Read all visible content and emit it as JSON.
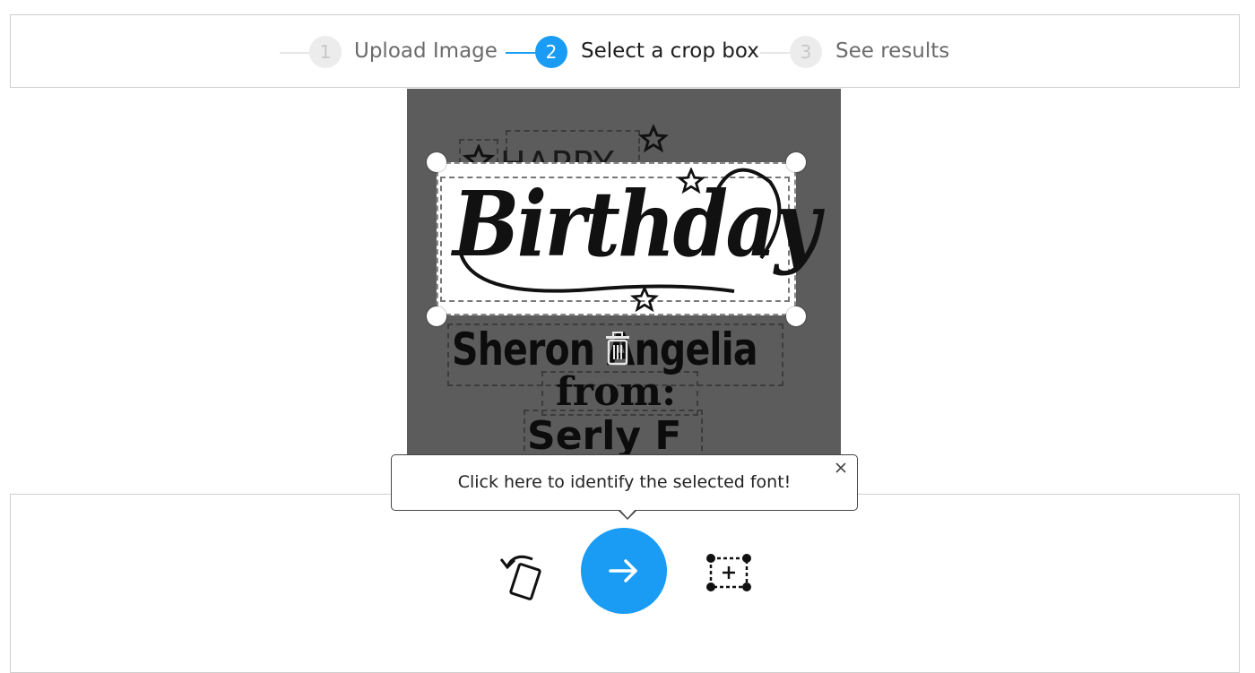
{
  "stepper": {
    "steps": [
      {
        "number": "1",
        "label": "Upload Image",
        "state": "inactive"
      },
      {
        "number": "2",
        "label": "Select a crop box",
        "state": "active"
      },
      {
        "number": "3",
        "label": "See results",
        "state": "inactive"
      }
    ]
  },
  "image": {
    "happy": "HAPPY",
    "birthday": "Birthday",
    "name": "Sheron Angelia",
    "from": "from:",
    "sender": "Serly F"
  },
  "tooltip": {
    "text": "Click here to identify the selected font!",
    "close_icon": "close-icon"
  },
  "toolbar": {
    "rotate_icon": "rotate-icon",
    "identify_icon": "arrow-right-icon",
    "add_box_icon": "add-crop-box-icon"
  },
  "colors": {
    "accent": "#1a9cf5",
    "canvas_bg": "#5c5c5c",
    "border": "#cfcfcf"
  }
}
